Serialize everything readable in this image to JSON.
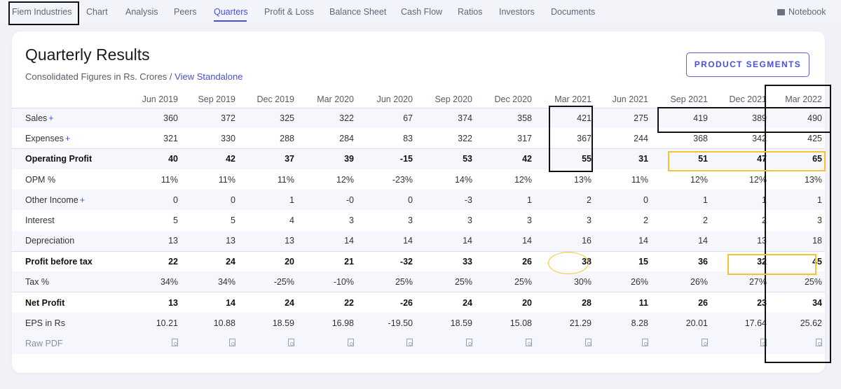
{
  "nav": {
    "items": [
      "Fiem Industries",
      "Chart",
      "Analysis",
      "Peers",
      "Quarters",
      "Profit & Loss",
      "Balance Sheet",
      "Cash Flow",
      "Ratios",
      "Investors",
      "Documents"
    ],
    "active": "Quarters",
    "notebook": "Notebook"
  },
  "header": {
    "title": "Quarterly Results",
    "subtitle_prefix": "Consolidated Figures in Rs. Crores / ",
    "subtitle_link": "View Standalone",
    "segments_button": "PRODUCT SEGMENTS"
  },
  "table": {
    "columns": [
      "Jun 2019",
      "Sep 2019",
      "Dec 2019",
      "Mar 2020",
      "Jun 2020",
      "Sep 2020",
      "Dec 2020",
      "Mar 2021",
      "Jun 2021",
      "Sep 2021",
      "Dec 2021",
      "Mar 2022"
    ],
    "rows": [
      {
        "label": "Sales",
        "plus": "+",
        "bold": false,
        "values": [
          "360",
          "372",
          "325",
          "322",
          "67",
          "374",
          "358",
          "421",
          "275",
          "419",
          "389",
          "490"
        ]
      },
      {
        "label": "Expenses",
        "plus": "+",
        "bold": false,
        "values": [
          "321",
          "330",
          "288",
          "284",
          "83",
          "322",
          "317",
          "367",
          "244",
          "368",
          "342",
          "425"
        ]
      },
      {
        "label": "Operating Profit",
        "plus": "",
        "bold": true,
        "values": [
          "40",
          "42",
          "37",
          "39",
          "-15",
          "53",
          "42",
          "55",
          "31",
          "51",
          "47",
          "65"
        ]
      },
      {
        "label": "OPM %",
        "plus": "",
        "bold": false,
        "values": [
          "11%",
          "11%",
          "11%",
          "12%",
          "-23%",
          "14%",
          "12%",
          "13%",
          "11%",
          "12%",
          "12%",
          "13%"
        ]
      },
      {
        "label": "Other Income",
        "plus": "+",
        "bold": false,
        "values": [
          "0",
          "0",
          "1",
          "-0",
          "0",
          "-3",
          "1",
          "2",
          "0",
          "1",
          "1",
          "1"
        ]
      },
      {
        "label": "Interest",
        "plus": "",
        "bold": false,
        "values": [
          "5",
          "5",
          "4",
          "3",
          "3",
          "3",
          "3",
          "3",
          "2",
          "2",
          "2",
          "3"
        ]
      },
      {
        "label": "Depreciation",
        "plus": "",
        "bold": false,
        "values": [
          "13",
          "13",
          "13",
          "14",
          "14",
          "14",
          "14",
          "16",
          "14",
          "14",
          "13",
          "18"
        ]
      },
      {
        "label": "Profit before tax",
        "plus": "",
        "bold": true,
        "values": [
          "22",
          "24",
          "20",
          "21",
          "-32",
          "33",
          "26",
          "38",
          "15",
          "36",
          "32",
          "45"
        ]
      },
      {
        "label": "Tax %",
        "plus": "",
        "bold": false,
        "values": [
          "34%",
          "34%",
          "-25%",
          "-10%",
          "25%",
          "25%",
          "25%",
          "30%",
          "26%",
          "26%",
          "27%",
          "25%"
        ]
      },
      {
        "label": "Net Profit",
        "plus": "",
        "bold": true,
        "values": [
          "13",
          "14",
          "24",
          "22",
          "-26",
          "24",
          "20",
          "28",
          "11",
          "26",
          "23",
          "34"
        ]
      },
      {
        "label": "EPS in Rs",
        "plus": "",
        "bold": false,
        "values": [
          "10.21",
          "10.88",
          "18.59",
          "16.98",
          "-19.50",
          "18.59",
          "15.08",
          "21.29",
          "8.28",
          "20.01",
          "17.64",
          "25.62"
        ]
      }
    ],
    "raw_pdf_label": "Raw PDF"
  },
  "colors": {
    "accent": "#4a4fd8",
    "annotation_black": "#111111",
    "annotation_yellow": "#f4c430"
  }
}
